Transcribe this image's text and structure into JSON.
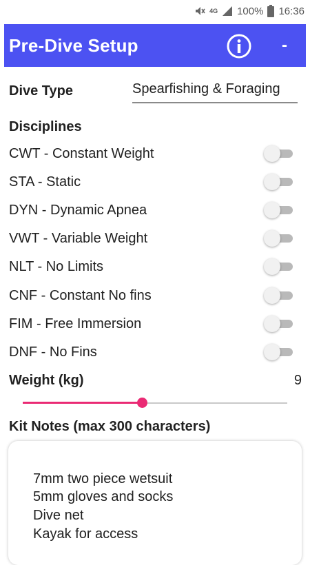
{
  "status_bar": {
    "battery_percent": "100%",
    "time": "16:36",
    "network": "4G",
    "icons": [
      "mute-icon",
      "signal-icon",
      "battery-icon"
    ]
  },
  "app_bar": {
    "title": "Pre-Dive Setup",
    "info_icon": "info-icon",
    "menu_label": "-",
    "color": "#4c52f2"
  },
  "dive_type": {
    "label": "Dive Type",
    "value": "Spearfishing & Foraging"
  },
  "disciplines": {
    "heading": "Disciplines",
    "items": [
      {
        "label": "CWT - Constant Weight",
        "enabled": false
      },
      {
        "label": "STA - Static",
        "enabled": false
      },
      {
        "label": "DYN - Dynamic Apnea",
        "enabled": false
      },
      {
        "label": "VWT - Variable Weight",
        "enabled": false
      },
      {
        "label": "NLT - No Limits",
        "enabled": false
      },
      {
        "label": "CNF - Constant No fins",
        "enabled": false
      },
      {
        "label": "FIM - Free Immersion",
        "enabled": false
      },
      {
        "label": "DNF - No Fins",
        "enabled": false
      }
    ]
  },
  "weight": {
    "label": "Weight (kg)",
    "value": "9",
    "slider_fraction": 0.45,
    "accent_color": "#ea2a74"
  },
  "kit_notes": {
    "label": "Kit Notes (max 300 characters)",
    "lines": [
      "7mm two piece wetsuit",
      "5mm gloves and socks",
      "Dive net",
      "Kayak for access"
    ]
  }
}
